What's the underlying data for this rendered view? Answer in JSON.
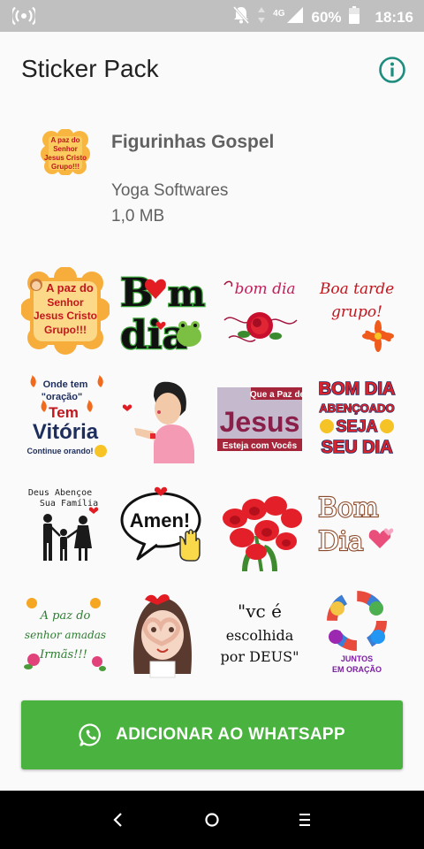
{
  "status_bar": {
    "network_type": "4G",
    "battery_percent": "60%",
    "time": "18:16",
    "icons": [
      "broadcast-icon",
      "notifications-off-icon",
      "data-arrows-icon",
      "signal-icon",
      "battery-icon"
    ]
  },
  "app_bar": {
    "title": "Sticker Pack",
    "info_icon": "info-icon"
  },
  "pack": {
    "name": "Figurinhas Gospel",
    "publisher": "Yoga Softwares",
    "size": "1,0 MB",
    "tray_lines": [
      "A paz do",
      "Senhor",
      "Jesus Cristo",
      "Grupo!!!"
    ]
  },
  "stickers": {
    "s1": [
      "A paz do",
      "Senhor",
      "Jesus Cristo",
      "Grupo!!!"
    ],
    "s2": [
      "B",
      "m",
      "dia"
    ],
    "s3": "bom dia",
    "s4": [
      "Boa tarde",
      "grupo!"
    ],
    "s5": [
      "Onde tem",
      "\"oração\"",
      "Tem",
      "Vitória",
      "Continue orando!"
    ],
    "s6": "",
    "s7": [
      "Que a Paz de",
      "Jesus",
      "Esteja com Vocês"
    ],
    "s8": [
      "BOM DIA",
      "ABENÇOADO",
      "SEJA",
      "SEU DIA"
    ],
    "s9": [
      "Deus Abençoe",
      "Sua Família"
    ],
    "s10": "Amen!",
    "s11": "",
    "s12": [
      "Bom",
      "Dia"
    ],
    "s13": [
      "A paz do",
      "senhor amadas",
      "Irmãs!!!"
    ],
    "s14": "",
    "s15": [
      "\"vc   é",
      "escolhida",
      "por DEUS\""
    ],
    "s16": [
      "JUNTOS",
      "EM ORAÇÃO"
    ]
  },
  "add_button": {
    "label": "ADICIONAR AO WHATSAPP",
    "icon": "whatsapp-icon",
    "color": "#4ab33f"
  },
  "nav_bar": {
    "icons": [
      "back-icon",
      "home-icon",
      "recents-icon"
    ]
  },
  "colors": {
    "accent": "#1e8c7e",
    "status_bar": "#c0c0c0"
  }
}
